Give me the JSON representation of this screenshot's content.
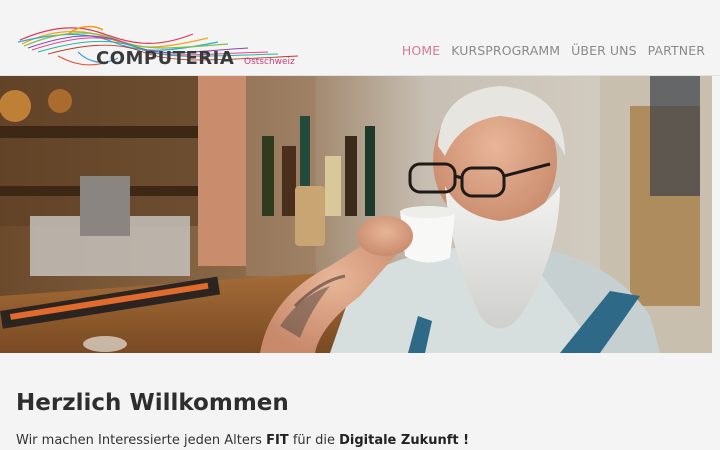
{
  "logo": {
    "title": "COMPUTERIA",
    "subtitle": "Ostschweiz"
  },
  "nav": {
    "items": [
      {
        "label": "HOME",
        "active": true
      },
      {
        "label": "KURSPROGRAMM",
        "active": false
      },
      {
        "label": "ÜBER UNS",
        "active": false
      },
      {
        "label": "PARTNER",
        "active": false
      }
    ]
  },
  "main": {
    "heading": "Herzlich Willkommen",
    "tagline": {
      "part1": "Wir machen Interessierte jeden Alters ",
      "bold1": "FIT",
      "part2": " für die ",
      "bold2": "Digitale Zukunft !"
    }
  },
  "colors": {
    "accent": "#d17a96",
    "nav_text": "#8a8a8a",
    "brand_pink": "#c93b7a",
    "background": "#f4f4f4"
  }
}
